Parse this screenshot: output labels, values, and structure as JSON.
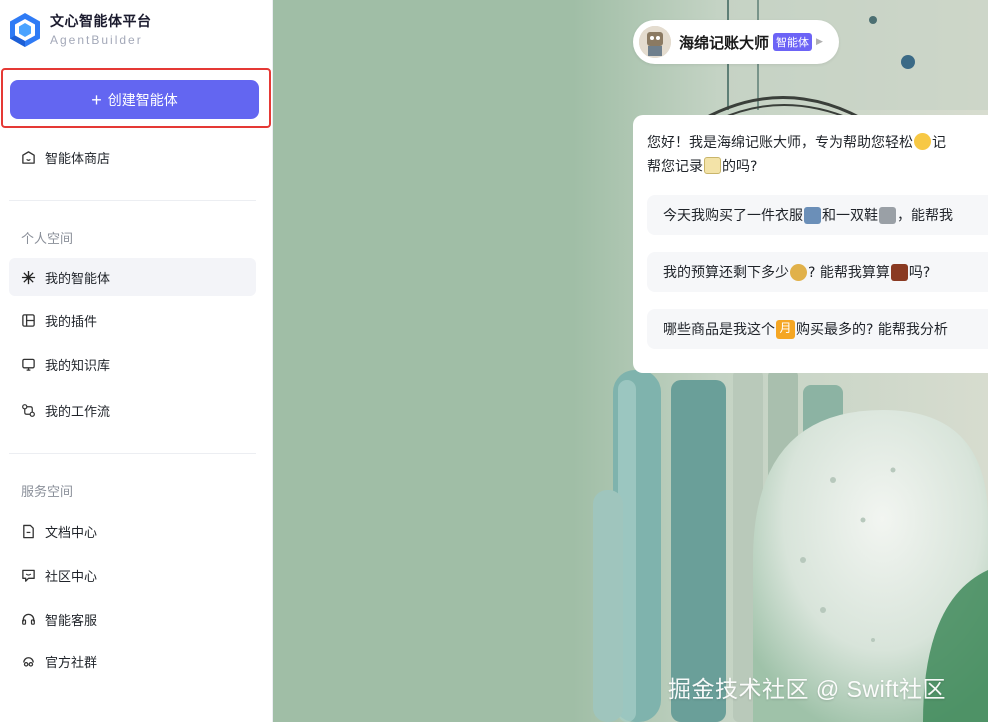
{
  "brand": {
    "title": "文心智能体平台",
    "subtitle": "AgentBuilder"
  },
  "create_button": {
    "label": "创建智能体",
    "icon": "plus-icon"
  },
  "nav": {
    "store": {
      "label": "智能体商店",
      "icon": "store-icon"
    },
    "personal_title": "个人空间",
    "personal": [
      {
        "label": "我的智能体",
        "icon": "sparkle-icon"
      },
      {
        "label": "我的插件",
        "icon": "layout-icon"
      },
      {
        "label": "我的知识库",
        "icon": "monitor-icon"
      },
      {
        "label": "我的工作流",
        "icon": "workflow-icon"
      }
    ],
    "service_title": "服务空间",
    "service": [
      {
        "label": "文档中心",
        "icon": "document-icon"
      },
      {
        "label": "社区中心",
        "icon": "chat-icon"
      },
      {
        "label": "智能客服",
        "icon": "headset-icon"
      },
      {
        "label": "官方社群",
        "icon": "community-icon"
      }
    ]
  },
  "agent": {
    "name": "海绵记账大师",
    "badge": "智能体"
  },
  "chat": {
    "greeting_line1_a": "您好！我是海绵记账大师，专为帮助您轻松",
    "greeting_line1_b": "记",
    "greeting_line2_a": "帮您记录",
    "greeting_line2_b": "的吗?",
    "suggestions": [
      {
        "a": "今天我购买了一件衣服",
        "b": "和一双鞋",
        "c": "，能帮我"
      },
      {
        "a": "我的预算还剩下多少",
        "b": "? 能帮我算算",
        "c": "吗?"
      },
      {
        "a": "哪些商品是我这个",
        "emoji_text": "月",
        "b": "购买最多的? 能帮我分析"
      }
    ]
  },
  "watermark": "掘金技术社区 @ Swift社区",
  "colors": {
    "accent": "#6366f1",
    "highlight_border": "#e53935",
    "badge": "#6c63f6"
  }
}
